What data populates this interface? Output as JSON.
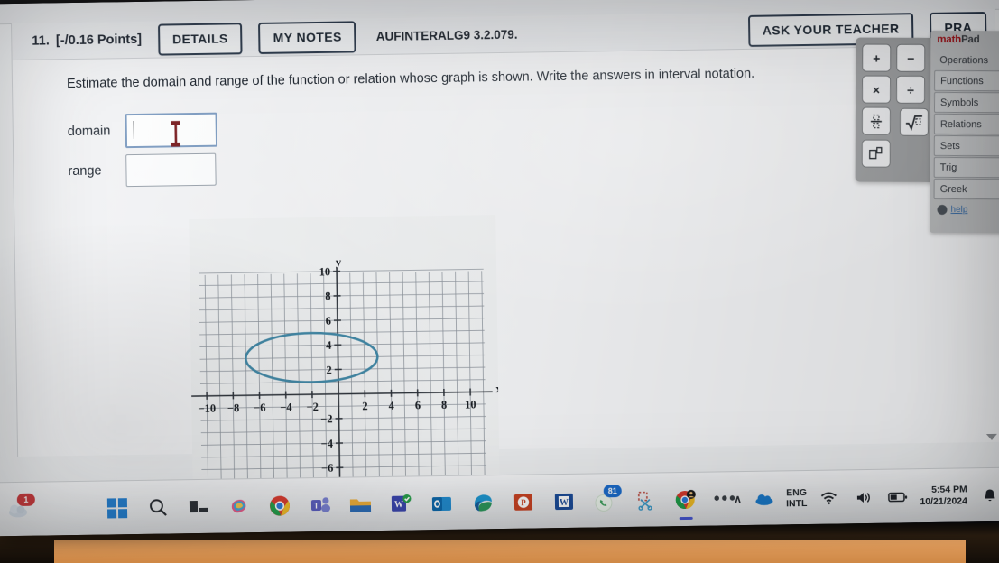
{
  "question": {
    "number": "11.",
    "points": "[-/0.16 Points]",
    "details_label": "DETAILS",
    "mynotes_label": "MY NOTES",
    "code": "AUFINTERALG9 3.2.079.",
    "ask_teacher_label": "ASK YOUR TEACHER",
    "practice_label": "PRA",
    "prompt": "Estimate the domain and range of the function or relation whose graph is shown. Write the answers in interval notation.",
    "fields": [
      {
        "label": "domain",
        "value": "",
        "focused": true
      },
      {
        "label": "range",
        "value": "",
        "focused": false
      }
    ]
  },
  "chart_data": {
    "type": "scatter",
    "title": "",
    "xlabel": "x",
    "ylabel": "y",
    "xlim": [
      -11,
      11
    ],
    "ylim": [
      -7.5,
      10.5
    ],
    "grid": true,
    "grid_step": 1,
    "xticks": [
      -10,
      -8,
      -6,
      -4,
      -2,
      2,
      4,
      6,
      8,
      10
    ],
    "yticks": [
      -6,
      -4,
      -2,
      2,
      4,
      6,
      8,
      10
    ],
    "xtick_labels": [
      "-10",
      "-8",
      "-6",
      "-4",
      "-2",
      "2",
      "4",
      "6",
      "8",
      "10"
    ],
    "ytick_labels": [
      "-6",
      "-4",
      "-2",
      "2",
      "4",
      "6",
      "8",
      "10"
    ],
    "legend": "none",
    "series": [
      {
        "name": "relation",
        "shape": "ellipse",
        "center_x": -2,
        "center_y": 3,
        "semi_axis_x": 5,
        "semi_axis_y": 2,
        "color": "#3d88a8",
        "stroke_width": 2.6,
        "x_extent": [
          -7,
          3
        ],
        "y_extent": [
          1,
          5
        ]
      }
    ],
    "annotations": []
  },
  "mathpad": {
    "logo_math": "math",
    "logo_pad": "Pad",
    "keys": [
      "+",
      "−",
      "×",
      "÷",
      "a/b",
      "√",
      "□^□"
    ],
    "categories": [
      "Operations",
      "Functions",
      "Symbols",
      "Relations",
      "Sets",
      "Trig",
      "Greek"
    ],
    "help_label": "help"
  },
  "taskbar": {
    "weather_badge": "1",
    "icons": [
      "weather-icon",
      "windows-start-icon",
      "search-icon",
      "task-view-icon",
      "copilot-icon",
      "chrome-icon",
      "teams-icon",
      "file-explorer-icon",
      "word-online-icon",
      "outlook-icon",
      "edge-icon",
      "powerpoint-icon",
      "word-icon",
      "whatsapp-icon",
      "snipping-tool-icon",
      "chrome-profile-icon"
    ],
    "whatsapp_badge": "81",
    "chrome_badge": "",
    "overflow_label": "•••",
    "tray": {
      "chevron": "∧",
      "language_line1": "ENG",
      "language_line2": "INTL",
      "time": "5:54 PM",
      "date": "10/21/2024"
    }
  },
  "colors": {
    "accent_blue": "#3d88a8",
    "button_border": "#2c3a4d",
    "focus_border": "#7d9dc4",
    "mathpad_red": "#a5151b",
    "badge_red": "#d13438"
  }
}
